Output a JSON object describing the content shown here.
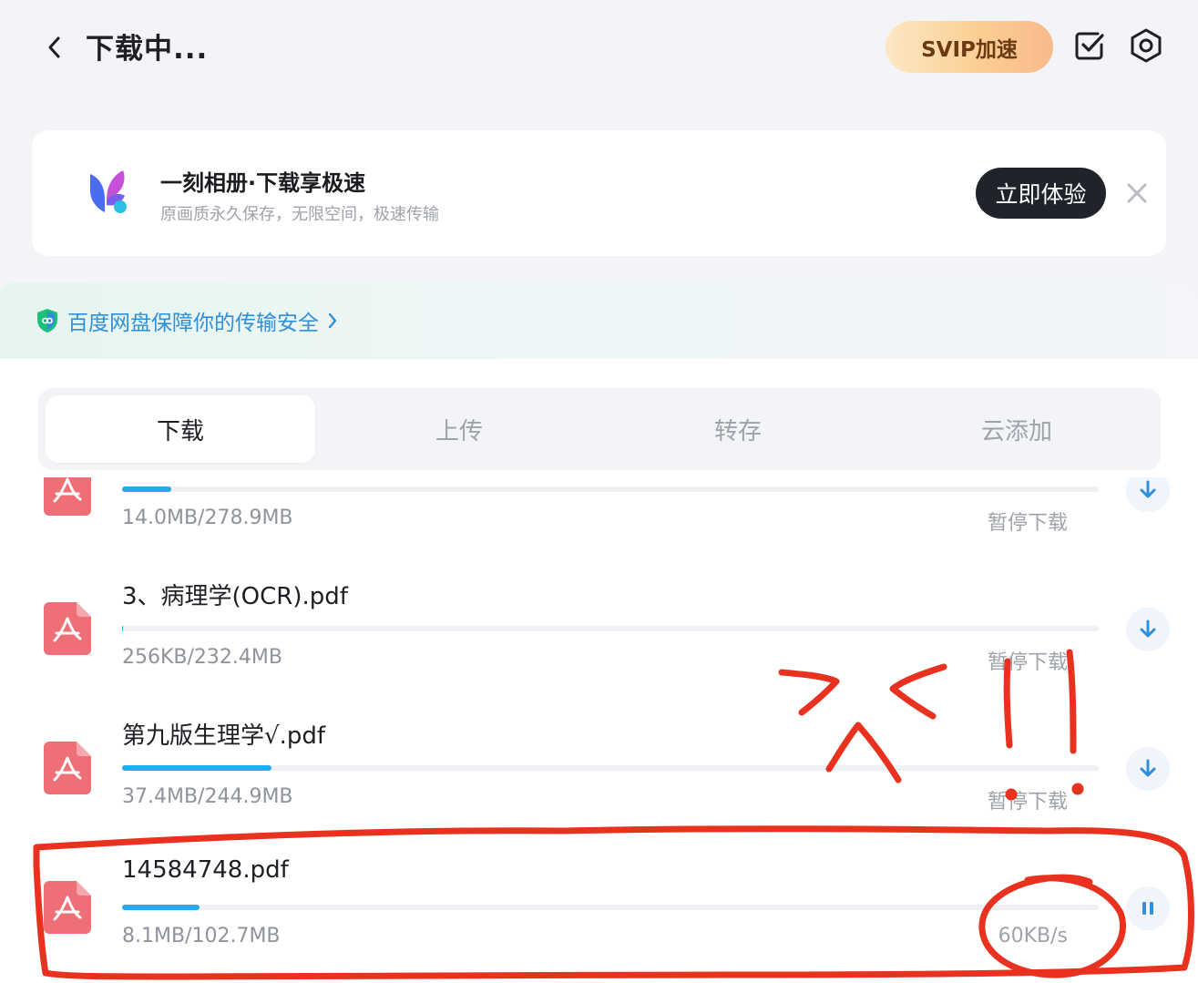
{
  "header": {
    "title": "下载中...",
    "svip_label": "SVIP加速"
  },
  "promo": {
    "title": "一刻相册·下载享极速",
    "subtitle": "原画质永久保存，无限空间，极速传输",
    "cta_label": "立即体验"
  },
  "security": {
    "text": "百度网盘保障你的传输安全"
  },
  "tabs": [
    {
      "label": "下载",
      "active": true
    },
    {
      "label": "上传",
      "active": false
    },
    {
      "label": "转存",
      "active": false
    },
    {
      "label": "云添加",
      "active": false
    }
  ],
  "downloads": [
    {
      "name": "",
      "size": "14.0MB/278.9MB",
      "progress": 0.05,
      "status": "暂停下载",
      "action_icon": "download-icon"
    },
    {
      "name": "3、病理学(OCR).pdf",
      "size": "256KB/232.4MB",
      "progress": 0.001,
      "status": "暂停下载",
      "action_icon": "download-icon"
    },
    {
      "name": "第九版生理学√.pdf",
      "size": "37.4MB/244.9MB",
      "progress": 0.153,
      "status": "暂停下载",
      "action_icon": "download-icon"
    },
    {
      "name": "14584748.pdf",
      "size": "8.1MB/102.7MB",
      "progress": 0.079,
      "status": "60KB/s",
      "action_icon": "pause-icon"
    }
  ],
  "colors": {
    "accent": "#27a9f0",
    "pdf_icon": "#ef6f76",
    "annotation": "#e8321f",
    "cta_bg": "#1f232b"
  }
}
